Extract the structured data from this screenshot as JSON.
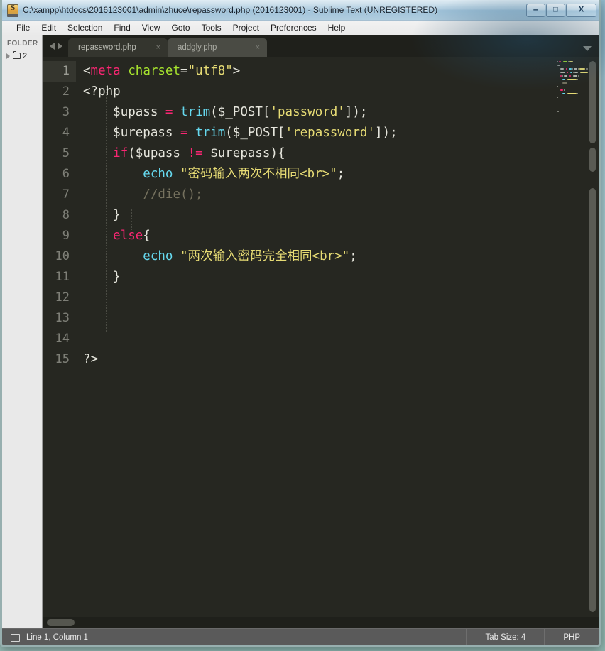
{
  "window": {
    "title": "C:\\xampp\\htdocs\\2016123001\\admin\\zhuce\\repassword.php (2016123001) - Sublime Text (UNREGISTERED)",
    "app_icon": "sublime-text-icon",
    "minimize_label": "–",
    "maximize_label": "□",
    "close_label": "X"
  },
  "menubar": {
    "items": [
      {
        "label": "File"
      },
      {
        "label": "Edit"
      },
      {
        "label": "Selection"
      },
      {
        "label": "Find"
      },
      {
        "label": "View"
      },
      {
        "label": "Goto"
      },
      {
        "label": "Tools"
      },
      {
        "label": "Project"
      },
      {
        "label": "Preferences"
      },
      {
        "label": "Help"
      }
    ]
  },
  "sidebar": {
    "heading": "FOLDER",
    "folder": {
      "label": "2",
      "icon": "folder-icon",
      "disclosure": "collapsed"
    }
  },
  "tabbar": {
    "prev_label": "◀",
    "next_label": "▶",
    "close_label": "×",
    "dropdown_label": "▼",
    "tabs": [
      {
        "label": "repassword.php",
        "active": true
      },
      {
        "label": "addgly.php",
        "active": false
      }
    ]
  },
  "editor": {
    "line_numbers": [
      "1",
      "2",
      "3",
      "4",
      "5",
      "6",
      "7",
      "8",
      "9",
      "10",
      "11",
      "12",
      "13",
      "14",
      "15"
    ],
    "active_line": 1,
    "lines": [
      {
        "n": "1",
        "text": "<meta charset=\"utf8\">"
      },
      {
        "n": "2",
        "text": "<?php"
      },
      {
        "n": "3",
        "text": "    $upass = trim($_POST['password']);"
      },
      {
        "n": "4",
        "text": "    $urepass = trim($_POST['repassword']);"
      },
      {
        "n": "5",
        "text": "    if($upass != $urepass){"
      },
      {
        "n": "6",
        "text": "        echo \"密码输入两次不相同<br>\";"
      },
      {
        "n": "7",
        "text": "        //die();"
      },
      {
        "n": "8",
        "text": "    }"
      },
      {
        "n": "9",
        "text": "    else{"
      },
      {
        "n": "10",
        "text": "        echo \"两次输入密码完全相同<br>\";"
      },
      {
        "n": "11",
        "text": "    }"
      },
      {
        "n": "12",
        "text": ""
      },
      {
        "n": "13",
        "text": ""
      },
      {
        "n": "14",
        "text": ""
      },
      {
        "n": "15",
        "text": "?>"
      }
    ],
    "tokens": [
      [
        {
          "t": "<",
          "c": "punct"
        },
        {
          "t": "meta",
          "c": "tag"
        },
        {
          "t": " ",
          "c": "plain"
        },
        {
          "t": "charset",
          "c": "attr"
        },
        {
          "t": "=",
          "c": "punct"
        },
        {
          "t": "\"utf8\"",
          "c": "string"
        },
        {
          "t": ">",
          "c": "punct"
        }
      ],
      [
        {
          "t": "<?php",
          "c": "plain"
        }
      ],
      [
        {
          "t": "    ",
          "c": "plain"
        },
        {
          "t": "$upass",
          "c": "var"
        },
        {
          "t": " ",
          "c": "plain"
        },
        {
          "t": "=",
          "c": "op"
        },
        {
          "t": " ",
          "c": "plain"
        },
        {
          "t": "trim",
          "c": "func"
        },
        {
          "t": "(",
          "c": "punct"
        },
        {
          "t": "$_POST",
          "c": "var"
        },
        {
          "t": "[",
          "c": "punct"
        },
        {
          "t": "'password'",
          "c": "string"
        },
        {
          "t": "]);",
          "c": "punct"
        }
      ],
      [
        {
          "t": "    ",
          "c": "plain"
        },
        {
          "t": "$urepass",
          "c": "var"
        },
        {
          "t": " ",
          "c": "plain"
        },
        {
          "t": "=",
          "c": "op"
        },
        {
          "t": " ",
          "c": "plain"
        },
        {
          "t": "trim",
          "c": "func"
        },
        {
          "t": "(",
          "c": "punct"
        },
        {
          "t": "$_POST",
          "c": "var"
        },
        {
          "t": "[",
          "c": "punct"
        },
        {
          "t": "'repassword'",
          "c": "string"
        },
        {
          "t": "]);",
          "c": "punct"
        }
      ],
      [
        {
          "t": "    ",
          "c": "plain"
        },
        {
          "t": "if",
          "c": "kw"
        },
        {
          "t": "(",
          "c": "punct"
        },
        {
          "t": "$upass",
          "c": "var"
        },
        {
          "t": " ",
          "c": "plain"
        },
        {
          "t": "!=",
          "c": "op"
        },
        {
          "t": " ",
          "c": "plain"
        },
        {
          "t": "$urepass",
          "c": "var"
        },
        {
          "t": "){",
          "c": "punct"
        }
      ],
      [
        {
          "t": "        ",
          "c": "plain"
        },
        {
          "t": "echo",
          "c": "func"
        },
        {
          "t": " ",
          "c": "plain"
        },
        {
          "t": "\"密码输入两次不相同<br>\"",
          "c": "string"
        },
        {
          "t": ";",
          "c": "punct"
        }
      ],
      [
        {
          "t": "        ",
          "c": "plain"
        },
        {
          "t": "//die();",
          "c": "comment"
        }
      ],
      [
        {
          "t": "    }",
          "c": "punct"
        }
      ],
      [
        {
          "t": "    ",
          "c": "plain"
        },
        {
          "t": "else",
          "c": "kw"
        },
        {
          "t": "{",
          "c": "punct"
        }
      ],
      [
        {
          "t": "        ",
          "c": "plain"
        },
        {
          "t": "echo",
          "c": "func"
        },
        {
          "t": " ",
          "c": "plain"
        },
        {
          "t": "\"两次输入密码完全相同<br>\"",
          "c": "string"
        },
        {
          "t": ";",
          "c": "punct"
        }
      ],
      [
        {
          "t": "    }",
          "c": "punct"
        }
      ],
      [],
      [],
      [],
      [
        {
          "t": "?>",
          "c": "plain"
        }
      ]
    ]
  },
  "statusbar": {
    "sidebar_toggle_icon": "sidebar-toggle-icon",
    "position": "Line 1, Column 1",
    "tab_size": "Tab Size: 4",
    "syntax": "PHP"
  },
  "colors": {
    "editor_bg": "#262721",
    "gutter_text": "#7e7f77",
    "tag": "#f92672",
    "attribute": "#a6e22e",
    "string": "#e6db74",
    "function": "#66d9ef",
    "comment": "#75715e",
    "text": "#e6e6dd",
    "tab_active_bg": "#34352e",
    "tab_inactive_bg": "#4a4b44",
    "statusbar_bg": "#5a5a5a"
  }
}
